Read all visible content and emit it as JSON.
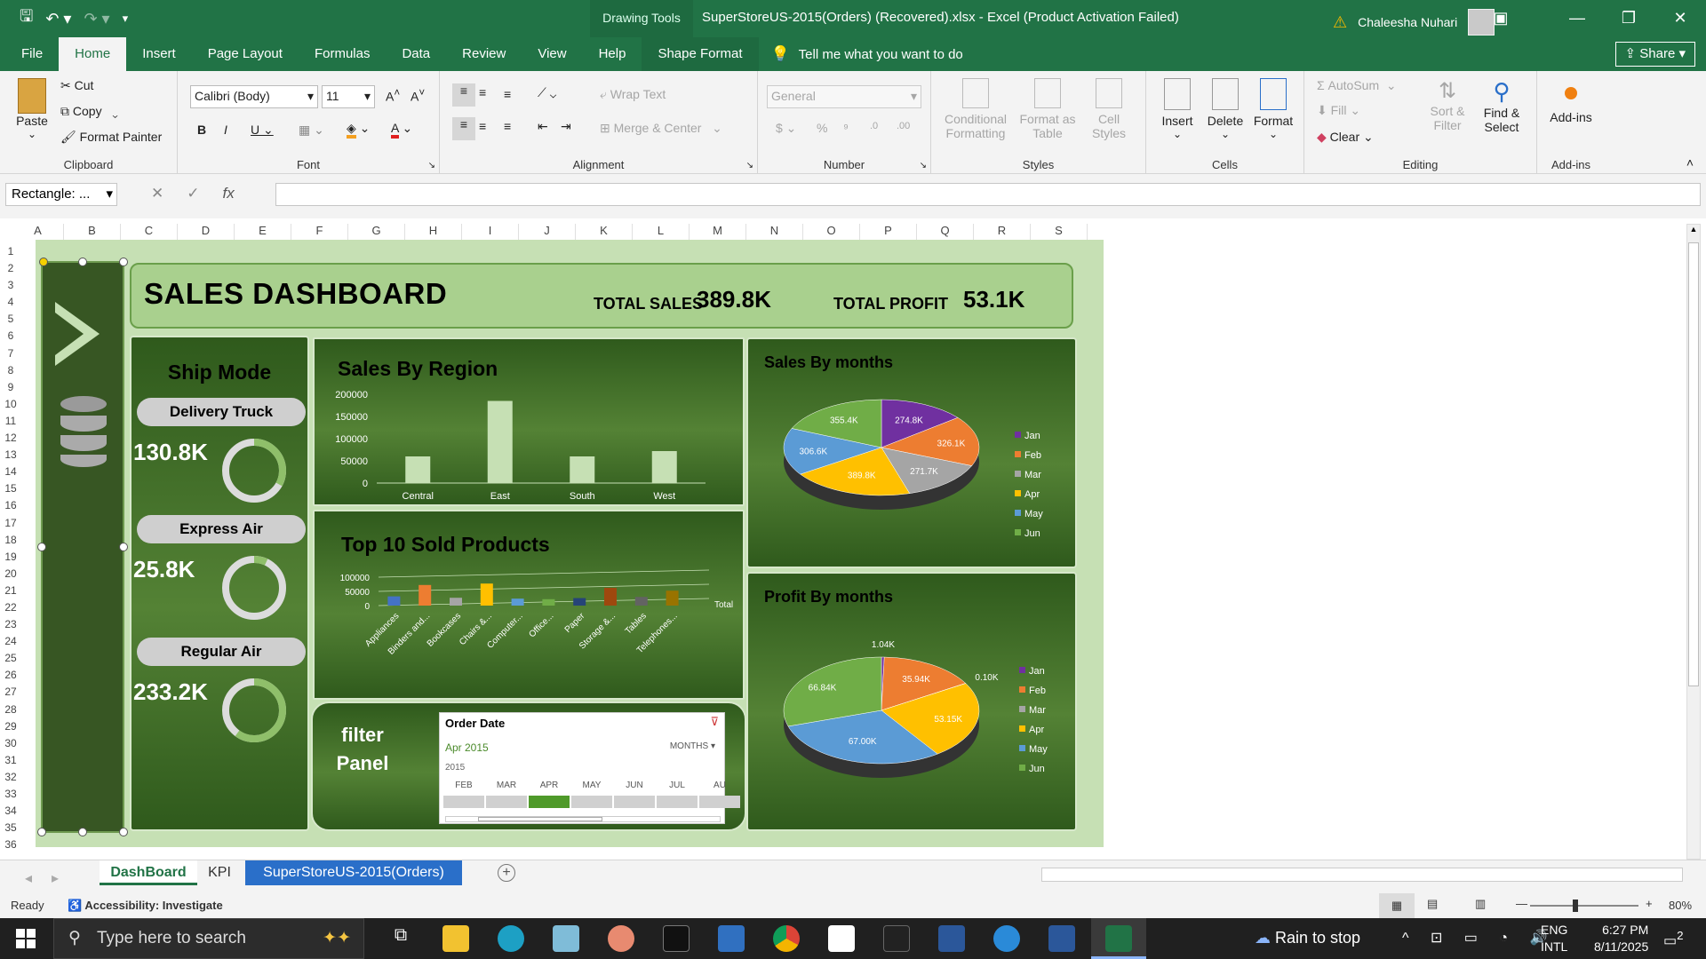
{
  "titlebar": {
    "drawing_tools": "Drawing Tools",
    "title": "SuperStoreUS-2015(Orders) (Recovered).xlsx  -  Excel (Product Activation Failed)",
    "user": "Chaleesha Nuhari"
  },
  "menu": {
    "tabs": [
      "File",
      "Home",
      "Insert",
      "Page Layout",
      "Formulas",
      "Data",
      "Review",
      "View",
      "Help",
      "Shape Format"
    ],
    "tell": "Tell me what you want to do",
    "share": "Share"
  },
  "ribbon": {
    "clipboard": {
      "paste": "Paste",
      "cut": "Cut",
      "copy": "Copy",
      "format_painter": "Format Painter",
      "label": "Clipboard"
    },
    "font": {
      "name": "Calibri (Body)",
      "size": "11",
      "label": "Font"
    },
    "alignment": {
      "wrap": "Wrap Text",
      "merge": "Merge & Center",
      "label": "Alignment"
    },
    "number": {
      "format": "General",
      "label": "Number"
    },
    "styles": {
      "cond": "Conditional Formatting",
      "table": "Format as Table",
      "cell": "Cell Styles",
      "label": "Styles"
    },
    "cells": {
      "insert": "Insert",
      "delete": "Delete",
      "format": "Format",
      "label": "Cells"
    },
    "editing": {
      "autosum": "AutoSum",
      "fill": "Fill",
      "clear": "Clear",
      "sort": "Sort & Filter",
      "find": "Find & Select",
      "label": "Editing"
    },
    "addins": {
      "btn": "Add-ins",
      "label": "Add-ins"
    }
  },
  "formula": {
    "namebox": "Rectangle: ...",
    "fx": "fx"
  },
  "columns": [
    "A",
    "B",
    "C",
    "D",
    "E",
    "F",
    "G",
    "H",
    "I",
    "J",
    "K",
    "L",
    "M",
    "N",
    "O",
    "P",
    "Q",
    "R",
    "S"
  ],
  "rows": [
    "1",
    "2",
    "3",
    "4",
    "5",
    "6",
    "7",
    "8",
    "9",
    "10",
    "11",
    "12",
    "13",
    "14",
    "15",
    "16",
    "17",
    "18",
    "19",
    "20",
    "21",
    "22",
    "23",
    "24",
    "25",
    "26",
    "27",
    "28",
    "29",
    "30",
    "31",
    "32",
    "33",
    "34",
    "35",
    "36"
  ],
  "dashboard": {
    "title": "SALES DASHBOARD",
    "total_sales_label": "TOTAL SALES",
    "total_sales": "389.8K",
    "total_profit_label": "TOTAL PROFIT",
    "total_profit": "53.1K",
    "ship": {
      "title": "Ship Mode",
      "modes": [
        {
          "name": "Delivery Truck",
          "value": "130.8K",
          "share": 0.33
        },
        {
          "name": "Express Air",
          "value": "25.8K",
          "share": 0.07
        },
        {
          "name": "Regular Air",
          "value": "233.2K",
          "share": 0.6
        }
      ]
    },
    "region_title": "Sales By Region",
    "top10_title": "Top 10 Sold Products",
    "sales_months_title": "Sales By months",
    "profit_months_title": "Profit By months",
    "filter": {
      "title1": "filter",
      "title2": "Panel",
      "header": "Order Date",
      "period": "Apr 2015",
      "level": "MONTHS",
      "year": "2015",
      "months": [
        "FEB",
        "MAR",
        "APR",
        "MAY",
        "JUN",
        "JUL",
        "AU"
      ]
    }
  },
  "chart_data": [
    {
      "type": "bar",
      "title": "Sales By Region",
      "categories": [
        "Central",
        "East",
        "South",
        "West"
      ],
      "values": [
        60000,
        185000,
        60000,
        72000
      ],
      "ylim": [
        0,
        200000
      ],
      "yticks": [
        "200000",
        "150000",
        "100000",
        "50000",
        "0"
      ]
    },
    {
      "type": "bar",
      "title": "Top 10 Sold Products",
      "categories": [
        "Appliances",
        "Binders and...",
        "Bookcases",
        "Chairs &...",
        "Computer...",
        "Office...",
        "Paper",
        "Storage &...",
        "Tables",
        "Telephones..."
      ],
      "values": [
        20000,
        60000,
        15000,
        65000,
        12000,
        10000,
        14000,
        50000,
        18000,
        40000
      ],
      "series": [
        {
          "name": "Total",
          "values": [
            20000,
            60000,
            15000,
            65000,
            12000,
            10000,
            14000,
            50000,
            18000,
            40000
          ]
        }
      ],
      "ylim": [
        0,
        100000
      ],
      "yticks": [
        "100000",
        "50000",
        "0"
      ]
    },
    {
      "type": "pie",
      "title": "Sales By months",
      "categories": [
        "Jan",
        "Feb",
        "Mar",
        "Apr",
        "May",
        "Jun"
      ],
      "values": [
        274.8,
        326.1,
        271.7,
        389.8,
        306.6,
        355.4
      ],
      "labels": [
        "274.8K",
        "326.1K",
        "271.7K",
        "389.8K",
        "306.6K",
        "355.4K"
      ],
      "colors": [
        "#7030a0",
        "#ed7d31",
        "#a5a5a5",
        "#ffc000",
        "#5b9bd5",
        "#70ad47"
      ]
    },
    {
      "type": "pie",
      "title": "Profit By months",
      "categories": [
        "Jan",
        "Feb",
        "Mar",
        "Apr",
        "May",
        "Jun"
      ],
      "values": [
        1.04,
        35.94,
        0.1,
        53.15,
        67.0,
        66.84
      ],
      "labels": [
        "1.04K",
        "35.94K",
        "0.10K",
        "53.15K",
        "67.00K",
        "66.84K"
      ],
      "colors": [
        "#7030a0",
        "#ed7d31",
        "#a5a5a5",
        "#ffc000",
        "#5b9bd5",
        "#70ad47"
      ]
    }
  ],
  "sheets": [
    "DashBoard",
    "KPI",
    "SuperStoreUS-2015(Orders)"
  ],
  "status": {
    "ready": "Ready",
    "accessibility": "Accessibility: Investigate",
    "zoom": "80%"
  },
  "taskbar": {
    "search": "Type here to search",
    "weather": "Rain to stop",
    "lang1": "ENG",
    "lang2": "INTL",
    "time": "6:27 PM",
    "date": "8/11/2025",
    "notif": "2"
  }
}
